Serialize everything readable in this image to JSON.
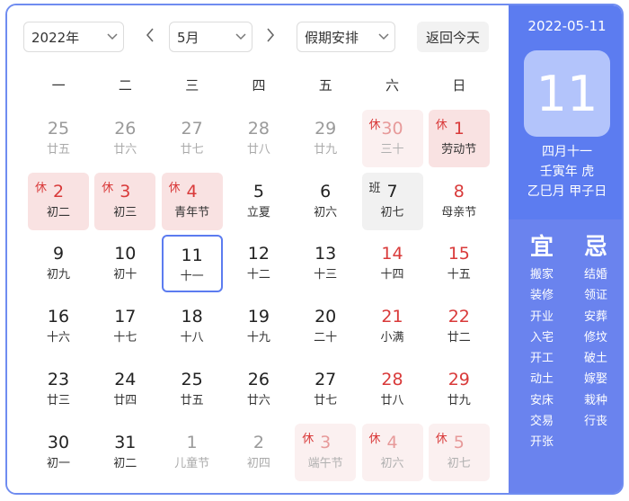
{
  "toolbar": {
    "year_value": "2022年",
    "month_value": "5月",
    "holiday_value": "假期安排",
    "today_button": "返回今天"
  },
  "weekdays": [
    "一",
    "二",
    "三",
    "四",
    "五",
    "六",
    "日"
  ],
  "days": [
    {
      "num": "25",
      "lunar": "廿五",
      "style": "other",
      "tag": ""
    },
    {
      "num": "26",
      "lunar": "廿六",
      "style": "other",
      "tag": ""
    },
    {
      "num": "27",
      "lunar": "廿七",
      "style": "other",
      "tag": ""
    },
    {
      "num": "28",
      "lunar": "廿八",
      "style": "other",
      "tag": ""
    },
    {
      "num": "29",
      "lunar": "廿九",
      "style": "other",
      "tag": ""
    },
    {
      "num": "30",
      "lunar": "三十",
      "style": "other-rest",
      "tag": "休"
    },
    {
      "num": "1",
      "lunar": "劳动节",
      "style": "rest",
      "tag": "休"
    },
    {
      "num": "2",
      "lunar": "初二",
      "style": "rest",
      "tag": "休"
    },
    {
      "num": "3",
      "lunar": "初三",
      "style": "rest",
      "tag": "休"
    },
    {
      "num": "4",
      "lunar": "青年节",
      "style": "rest",
      "tag": "休"
    },
    {
      "num": "5",
      "lunar": "立夏",
      "style": "norm",
      "tag": ""
    },
    {
      "num": "6",
      "lunar": "初六",
      "style": "norm",
      "tag": ""
    },
    {
      "num": "7",
      "lunar": "初七",
      "style": "work",
      "tag": "班"
    },
    {
      "num": "8",
      "lunar": "母亲节",
      "style": "red",
      "tag": ""
    },
    {
      "num": "9",
      "lunar": "初九",
      "style": "norm",
      "tag": ""
    },
    {
      "num": "10",
      "lunar": "初十",
      "style": "norm",
      "tag": ""
    },
    {
      "num": "11",
      "lunar": "十一",
      "style": "today",
      "tag": ""
    },
    {
      "num": "12",
      "lunar": "十二",
      "style": "norm",
      "tag": ""
    },
    {
      "num": "13",
      "lunar": "十三",
      "style": "norm",
      "tag": ""
    },
    {
      "num": "14",
      "lunar": "十四",
      "style": "red",
      "tag": ""
    },
    {
      "num": "15",
      "lunar": "十五",
      "style": "red",
      "tag": ""
    },
    {
      "num": "16",
      "lunar": "十六",
      "style": "norm",
      "tag": ""
    },
    {
      "num": "17",
      "lunar": "十七",
      "style": "norm",
      "tag": ""
    },
    {
      "num": "18",
      "lunar": "十八",
      "style": "norm",
      "tag": ""
    },
    {
      "num": "19",
      "lunar": "十九",
      "style": "norm",
      "tag": ""
    },
    {
      "num": "20",
      "lunar": "二十",
      "style": "norm",
      "tag": ""
    },
    {
      "num": "21",
      "lunar": "小满",
      "style": "red",
      "tag": ""
    },
    {
      "num": "22",
      "lunar": "廿二",
      "style": "red",
      "tag": ""
    },
    {
      "num": "23",
      "lunar": "廿三",
      "style": "norm",
      "tag": ""
    },
    {
      "num": "24",
      "lunar": "廿四",
      "style": "norm",
      "tag": ""
    },
    {
      "num": "25",
      "lunar": "廿五",
      "style": "norm",
      "tag": ""
    },
    {
      "num": "26",
      "lunar": "廿六",
      "style": "norm",
      "tag": ""
    },
    {
      "num": "27",
      "lunar": "廿七",
      "style": "norm",
      "tag": ""
    },
    {
      "num": "28",
      "lunar": "廿八",
      "style": "red",
      "tag": ""
    },
    {
      "num": "29",
      "lunar": "廿九",
      "style": "red",
      "tag": ""
    },
    {
      "num": "30",
      "lunar": "初一",
      "style": "norm",
      "tag": ""
    },
    {
      "num": "31",
      "lunar": "初二",
      "style": "norm",
      "tag": ""
    },
    {
      "num": "1",
      "lunar": "儿童节",
      "style": "other",
      "tag": ""
    },
    {
      "num": "2",
      "lunar": "初四",
      "style": "other",
      "tag": ""
    },
    {
      "num": "3",
      "lunar": "端午节",
      "style": "other-rest",
      "tag": "休"
    },
    {
      "num": "4",
      "lunar": "初六",
      "style": "other-rest",
      "tag": "休"
    },
    {
      "num": "5",
      "lunar": "初七",
      "style": "other-rest",
      "tag": "休"
    }
  ],
  "sidebar": {
    "date": "2022-05-11",
    "day": "11",
    "lunar_date": "四月十一",
    "ganzhi_year": "壬寅年 虎",
    "ganzhi_month_day": "乙巳月 甲子日",
    "yi_title": "宜",
    "ji_title": "忌",
    "yi_items": [
      "搬家",
      "装修",
      "开业",
      "入宅",
      "开工",
      "动土",
      "安床",
      "交易",
      "开张"
    ],
    "ji_items": [
      "结婚",
      "领证",
      "安葬",
      "修坟",
      "破土",
      "嫁娶",
      "栽种",
      "行丧"
    ]
  },
  "colors": {
    "accent": "#5c7cf0",
    "holiday_red": "#d93a3a",
    "rest_bg": "#f9e2e2",
    "work_bg": "#f1f1f1"
  }
}
